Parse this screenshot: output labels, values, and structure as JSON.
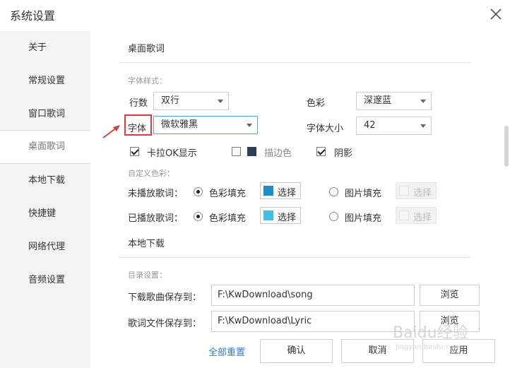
{
  "window": {
    "title": "系统设置"
  },
  "sidebar": {
    "items": [
      {
        "label": "关于"
      },
      {
        "label": "常规设置"
      },
      {
        "label": "窗口歌词"
      },
      {
        "label": "桌面歌词"
      },
      {
        "label": "本地下载"
      },
      {
        "label": "快捷键"
      },
      {
        "label": "网络代理"
      },
      {
        "label": "音频设置"
      }
    ],
    "active_index": 3
  },
  "desktop_lyrics": {
    "section_title": "桌面歌词",
    "font_style_group": "字体样式：",
    "rows_label": "行数",
    "rows_value": "双行",
    "color_label": "色彩",
    "color_value": "深邃蓝",
    "font_label": "字体",
    "font_value": "微软雅黑",
    "font_size_label": "字体大小",
    "font_size_value": "42",
    "karaoke_label": "卡拉OK显示",
    "karaoke_checked": true,
    "stroke_label": "描边色",
    "stroke_checked": false,
    "stroke_color": "#2b3e56",
    "shadow_label": "阴影",
    "shadow_checked": true,
    "custom_color_group": "自定义色彩：",
    "unplayed_label": "未播放歌词：",
    "played_label": "已播放歌词：",
    "color_fill_label": "色彩填充",
    "image_fill_label": "图片填充",
    "select_label": "选择",
    "unplayed_chip_color": "#1e90c8",
    "played_chip_color": "#40c0e8"
  },
  "local_download": {
    "section_title": "本地下载",
    "dir_group": "目录设置：",
    "song_label": "下载歌曲保存到：",
    "song_path": "F:\\KwDownload\\song",
    "lyric_label": "歌词文件保存到：",
    "lyric_path": "F:\\KwDownload\\Lyric",
    "browse_label": "浏览"
  },
  "footer": {
    "reset_label": "全部重置",
    "ok_label": "确认",
    "cancel_label": "取消",
    "apply_label": "应用"
  },
  "watermark": {
    "text": "Baidu经验",
    "sub": "jingyan.baidu.com"
  },
  "colors": {
    "accent": "#2d7fc9",
    "highlight": "#e03a3a"
  }
}
